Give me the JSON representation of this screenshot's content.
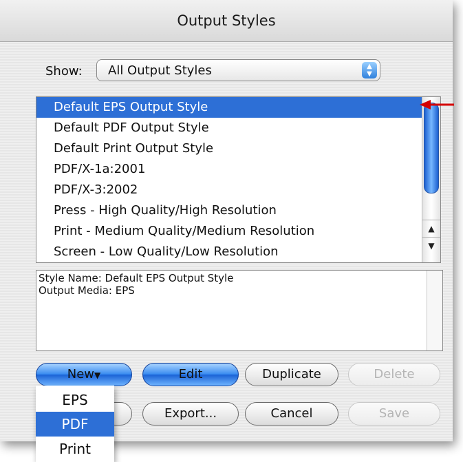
{
  "window": {
    "title": "Output Styles"
  },
  "show": {
    "label": "Show:",
    "selected": "All Output Styles"
  },
  "styles_list": {
    "items": [
      {
        "label": "Default EPS Output Style",
        "selected": true
      },
      {
        "label": "Default PDF Output Style",
        "selected": false
      },
      {
        "label": "Default Print Output Style",
        "selected": false
      },
      {
        "label": "PDF/X-1a:2001",
        "selected": false
      },
      {
        "label": "PDF/X-3:2002",
        "selected": false
      },
      {
        "label": "Press - High Quality/High Resolution",
        "selected": false
      },
      {
        "label": "Print - Medium Quality/Medium Resolution",
        "selected": false
      },
      {
        "label": "Screen - Low Quality/Low Resolution",
        "selected": false
      }
    ]
  },
  "description": {
    "lines": [
      "Style Name: Default EPS Output Style",
      "Output Media: EPS"
    ]
  },
  "buttons": {
    "new": "New",
    "edit": "Edit",
    "duplicate": "Duplicate",
    "delete": "Delete",
    "export": "Export...",
    "cancel": "Cancel",
    "save": "Save"
  },
  "new_menu": {
    "items": [
      {
        "label": "EPS",
        "selected": false
      },
      {
        "label": "PDF",
        "selected": true
      },
      {
        "label": "Print",
        "selected": false
      }
    ]
  },
  "colors": {
    "selection": "#2d6fd6",
    "annotation_arrow": "#d40000"
  }
}
